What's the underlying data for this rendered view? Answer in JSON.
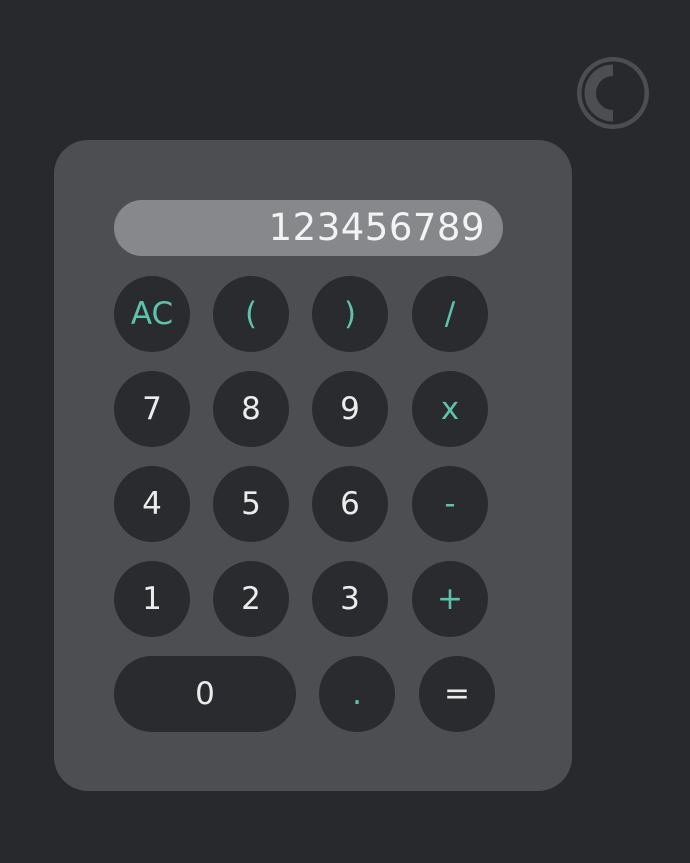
{
  "theme_toggle": {
    "icon": "contrast-icon"
  },
  "display": {
    "value": "123456789"
  },
  "colors": {
    "background": "#28292c",
    "calculator": "#4d4e51",
    "display": "#87888b",
    "button": "#2a2b2e",
    "digit_text": "#ececec",
    "operator_text": "#5ec3ad"
  },
  "buttons": {
    "clear": "AC",
    "open_paren": "(",
    "close_paren": ")",
    "divide": "/",
    "seven": "7",
    "eight": "8",
    "nine": "9",
    "multiply": "x",
    "four": "4",
    "five": "5",
    "six": "6",
    "subtract": "-",
    "one": "1",
    "two": "2",
    "three": "3",
    "add": "+",
    "zero": "0",
    "decimal": ".",
    "equals": "="
  }
}
